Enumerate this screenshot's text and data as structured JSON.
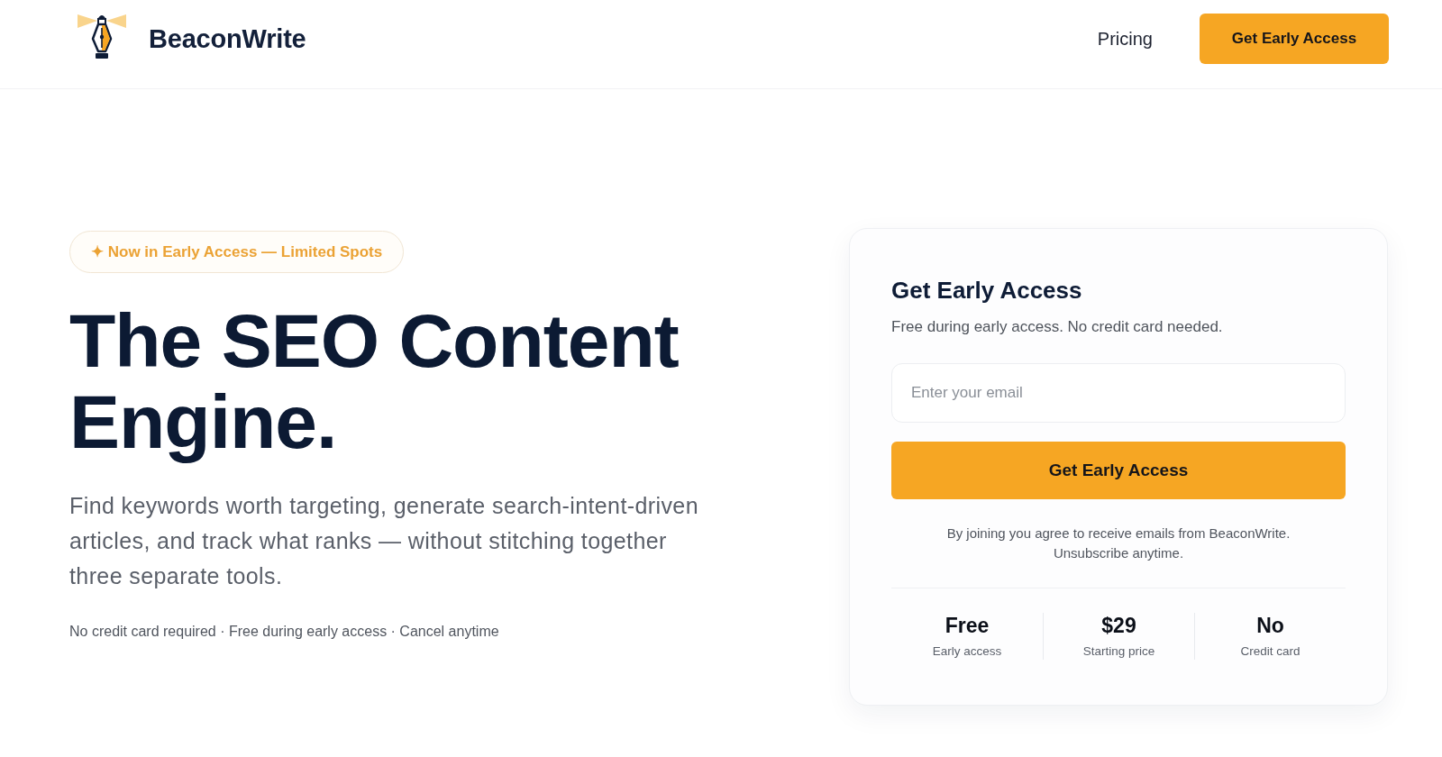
{
  "header": {
    "brand": "BeaconWrite",
    "nav": [
      {
        "label": "Pricing"
      }
    ],
    "cta": "Get Early Access"
  },
  "hero": {
    "badge": "✦ Now in Early Access — Limited Spots",
    "title": "The SEO Content Engine.",
    "description": "Find keywords worth targeting, generate search-intent-driven articles, and track what ranks — without stitching together three separate tools.",
    "footnote": "No credit card required · Free during early access · Cancel anytime"
  },
  "signup_card": {
    "title": "Get Early Access",
    "subtitle": "Free during early access. No credit card needed.",
    "email_field": {
      "placeholder": "Enter your email"
    },
    "button": "Get Early Access",
    "consent": "By joining you agree to receive emails from BeaconWrite. Unsubscribe anytime.",
    "stats": [
      {
        "value": "Free",
        "label": "Early access"
      },
      {
        "value": "$29",
        "label": "Starting price"
      },
      {
        "value": "No",
        "label": "Credit card"
      }
    ]
  }
}
